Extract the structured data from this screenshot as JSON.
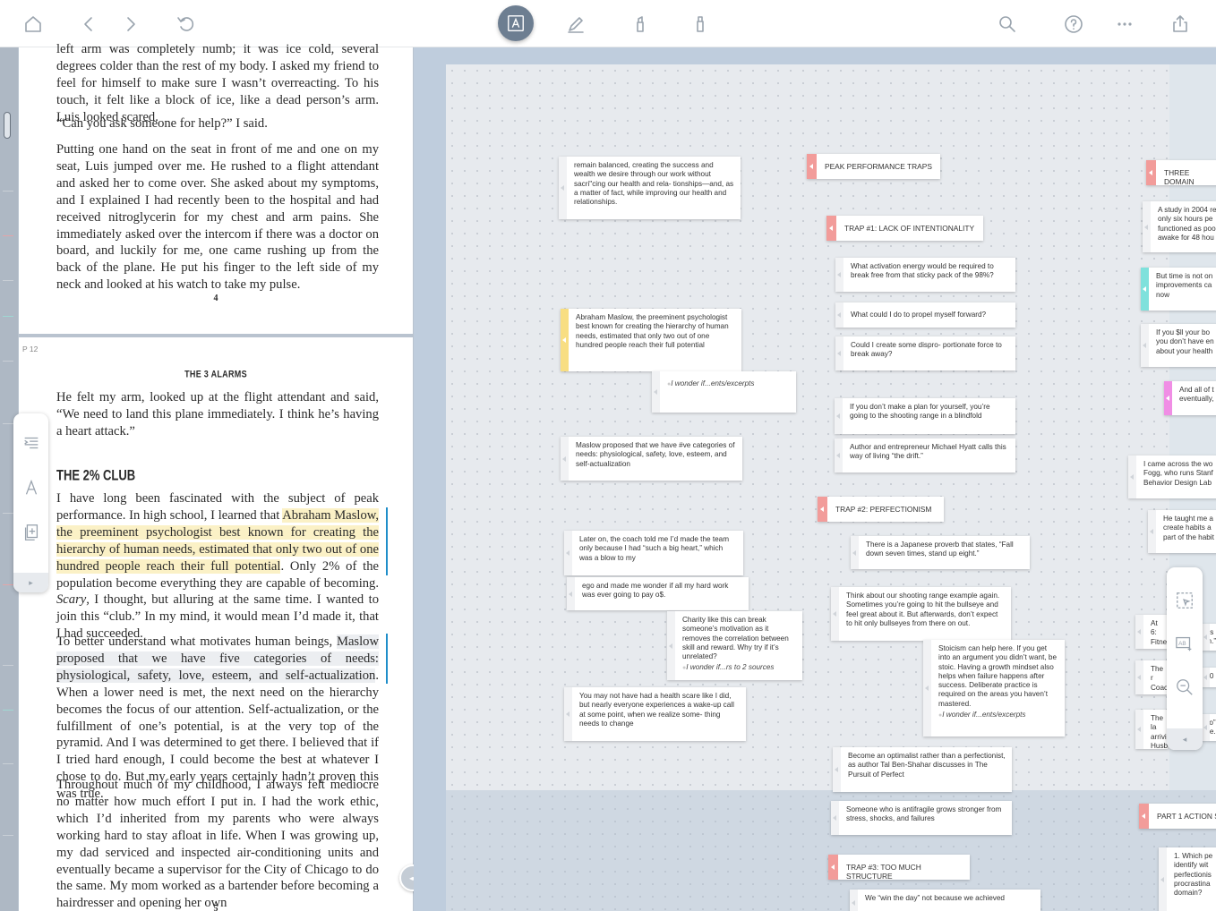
{
  "toolbar": {
    "home": "home-icon",
    "back": "chevron-left-icon",
    "forward": "chevron-right-icon",
    "undo": "undo-icon",
    "text_tool": "A",
    "pen": "pen-icon",
    "highlighter1": "highlighter-icon",
    "highlighter2": "eraser-icon",
    "search": "search-icon",
    "help": "?",
    "more": "···",
    "share": "share-icon",
    "accent": "#6d7e91"
  },
  "reader": {
    "top_page": {
      "p1": "left arm was completely numb; it was ice cold, several degrees colder than the rest of my body. I asked my friend to feel for himself to make sure I wasn’t overreacting. To his touch, it felt like a block of ice, like a dead person’s arm. Luis looked scared.",
      "p2": "“Can you ask someone for help?” I said.",
      "p3": "Putting one hand on the seat in front of me and one on my seat, Luis jumped over me. He rushed to a flight attendant and asked her to come over. She asked about my symptoms, and I explained I had recently been to the hospital and had received nitroglycerin for my chest and arm pains. She immediately asked over the intercom if there was a doctor on board, and luckily for me, one came rushing up from the back of the plane. He put his finger to the left side of my neck and looked at his watch to take my pulse.",
      "page_number": "4"
    },
    "bottom_page": {
      "label": "P 12",
      "running_head": "THE 3 ALARMS",
      "p1": "He felt my arm, looked up at the flight attendant and said, “We need to land this plane immediately. I think he’s having a heart attack.”",
      "section_title": "THE 2% CLUB",
      "p2_a": "I have long been fascinated with the subject of peak performance. In high school, I learned that ",
      "p2_hl": "Abraham Maslow, the preeminent psychologist best known for creating the hierarchy of human needs, estimated that only two out of one hundred people reach their full potential",
      "p2_b": ". Only 2% of the population become everything they are capable of becoming. ",
      "p2_scary": "Scary",
      "p2_c": ", I thought, but alluring at the same time. I wanted to join this “club.” In my mind, it would mean I’d made it, that I had succeeded.",
      "p3_a": "To better understand what motivates human beings, ",
      "p3_hl": "Maslow proposed that we have five categories of needs: physiological, safety, love, esteem, and self-actualization",
      "p3_b": ". When a lower need is met, the next need on the hierarchy becomes the focus of our attention. Self-actualization, or the fulfillment of one’s potential, is at the very top of the pyramid. And I was determined to get there. I believed that if I tried hard enough, I could become the best at whatever I chose to do. But my early years certainly hadn’t proven this was true.",
      "p4": "Throughout much of my childhood, I always felt mediocre no matter how much effort I put in. I had the work ethic, which I’d inherited from my parents who were always working hard to stay afloat in life. When I was growing up, my dad serviced and inspected air-conditioning units and eventually became a supervisor for the City of Chicago to do the same. My mom worked as a bartender before becoming a hairdresser and opening her own",
      "page_number": "5"
    },
    "highlight_colors": {
      "yellow": "#fbf1c6",
      "margin_bar": "#1f8ec9"
    }
  },
  "left_palette": {
    "tools": [
      "list-collapse-icon",
      "text-style-icon",
      "add-page-icon"
    ],
    "footer": "▸"
  },
  "divider": "◂▸",
  "mindmap": {
    "notes": {
      "n_balanced": "remain balanced, creating the success and wealth  we desire through our work without sacri\"cing our health and rela-  tionships—and, as a matter of fact, while improving our health and  relationships.",
      "n_maslow1": "Abraham Maslow, the preeminent psychologist best known for creating the hierarchy of human needs,  estimated that only two out of one hundred people reach their full potential",
      "n_wonder1": "I wonder if...ents/excerpts",
      "n_maslow2": "Maslow  proposed that we have #ve categories of needs: physiological, safety,  love, esteem, and self-actualization",
      "n_coach": "Later on, the coach told me I’d made the  team only because I had “such a big heart,” which was a blow to my",
      "n_ego": "ego and made me wonder if all my hard work was ever going to  pay o$.",
      "n_charity": "Charity like this can break someone’s motivation as it removes the correlation between skill and reward. Why try if it’s unrelated?",
      "n_charity_ref": "I wonder if...rs to 2 sources",
      "n_healthscare": "You may not have had a health scare like I did, but nearly everyone  experiences a wake-up call at some point, when we realize some-  thing needs to change",
      "h_peak": "PEAK PERFORMANCE TRAPS",
      "h_trap1": "TRAP #1: LACK OF INTENTIONALITY",
      "n_activation": "What activation energy would be  required to break free from that sticky pack of the 98%?",
      "n_propel": "What  could I do to propel myself forward?",
      "n_disproportionate": "Could I create some dispro-  portionate force to break away?",
      "n_blindfold": "If you don’t make a  plan for yourself, you’re going to the shooting range in a blindfold",
      "n_hyatt": "Author and entrepreneur Michael Hyatt calls this way of living  “the drift.”",
      "h_trap2": "TRAP #2: PERFECTIONISM",
      "n_japanese": "There is a Japanese proverb that states, “Fall down seven times,  stand up eight.”",
      "n_shooting": "Think about our shooting range example again. Sometimes you’re  going to hit the bullseye and feel great about it. But afterwards,  don’t expect to hit only bullseyes from there on out.",
      "n_stoicism": "Stoicism can help here. If you get into an argument you didn’t want, be stoic. Having a growth mindset also helps when failure happens after success. Deliberate practice is required on the areas you haven’t mastered.",
      "n_stoicism_ref": "I wonder if...ents/excerpts",
      "n_optimalist": "Become an optimalist rather than a perfectionist, as  author Tal Ben-Shahar discusses in The Pursuit of Perfect",
      "n_antifragile": "Someone who is antifragile grows stronger from stress, shocks, and  failures",
      "h_trap3": "TRAP #3: TOO MUCH STRUCTURE",
      "n_winday": "We “win the day” not because we achieved",
      "h_three": "THREE DOMAIN",
      "n_study": "A study in 2004 re only six hours pe functioned as poo awake for 48 hou",
      "n_time": "But time is not on improvements ca now",
      "n_ifyou": "If you $ll  your bo you don’t have en about your health",
      "n_andall": "And all of t eventually,",
      "n_fogg": "I came  across the wo Fogg, who runs Stanf Behavior Design Lab",
      "n_taught": "He taught me a create habits  a part of the habit",
      "n_at6": "At 6: Fitne",
      "n_at6b": "$rs on.”",
      "n_the": "The r Coac",
      "n_the_b": "9:0",
      "n_thela": "The la arrivin Husba",
      "n_thela_b": "s o” the.",
      "h_part1": "PART 1 ACTION S",
      "n_which": "1. Which pe identify wit perfectionis procrastina domain?"
    },
    "colors": {
      "header_tab": "#f29c9a",
      "yellow_tab": "#f8de82",
      "cyan_tab": "#7fe1dc",
      "magenta_tab": "#f08ee5"
    }
  },
  "right_palette": {
    "tools": [
      "lasso-select-icon",
      "add-text-box-icon",
      "zoom-out-icon"
    ],
    "footer": "◂",
    "badge": "AB"
  }
}
